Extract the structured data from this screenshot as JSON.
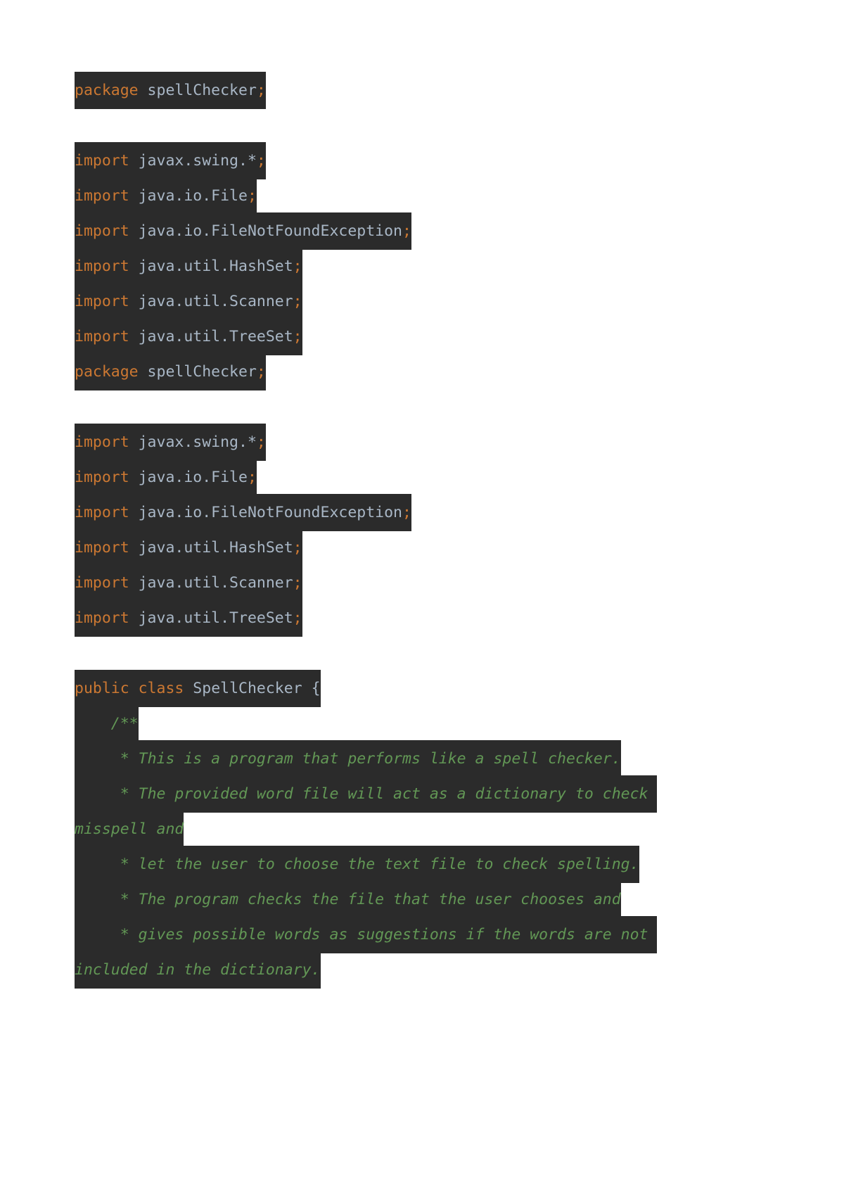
{
  "document": {
    "language": "java",
    "colors": {
      "page_background": "#ffffff",
      "code_background": "#2b2b2b",
      "keyword": "#cc7832",
      "identifier": "#a9b7c6",
      "comment": "#629755"
    }
  },
  "blocks": [
    {
      "id": "block-package-1",
      "lines": [
        {
          "id": "line-package-1",
          "kind": "package",
          "text": "package spellChecker;"
        }
      ]
    },
    {
      "id": "block-imports-1",
      "lines": [
        {
          "id": "line-import-1",
          "kind": "import",
          "text": "import javax.swing.*;"
        },
        {
          "id": "line-import-2",
          "kind": "import",
          "text": "import java.io.File;"
        },
        {
          "id": "line-import-3",
          "kind": "import",
          "text": "import java.io.FileNotFoundException;"
        },
        {
          "id": "line-import-4",
          "kind": "import",
          "text": "import java.util.HashSet;"
        },
        {
          "id": "line-import-5",
          "kind": "import",
          "text": "import java.util.Scanner;"
        },
        {
          "id": "line-import-6",
          "kind": "import",
          "text": "import java.util.TreeSet;"
        },
        {
          "id": "line-package-2",
          "kind": "package",
          "text": "package spellChecker;"
        }
      ]
    },
    {
      "id": "block-imports-2",
      "lines": [
        {
          "id": "line-import-7",
          "kind": "import",
          "text": "import javax.swing.*;"
        },
        {
          "id": "line-import-8",
          "kind": "import",
          "text": "import java.io.File;"
        },
        {
          "id": "line-import-9",
          "kind": "import",
          "text": "import java.io.FileNotFoundException;"
        },
        {
          "id": "line-import-10",
          "kind": "import",
          "text": "import java.util.HashSet;"
        },
        {
          "id": "line-import-11",
          "kind": "import",
          "text": "import java.util.Scanner;"
        },
        {
          "id": "line-import-12",
          "kind": "import",
          "text": "import java.util.TreeSet;"
        }
      ]
    },
    {
      "id": "block-class",
      "lines": [
        {
          "id": "line-class-decl",
          "kind": "class",
          "text": "public class SpellChecker {"
        },
        {
          "id": "line-javadoc-open",
          "kind": "comment",
          "text": "    /**"
        },
        {
          "id": "line-javadoc-1",
          "kind": "comment",
          "text": "     * This is a program that performs like a spell checker."
        },
        {
          "id": "line-javadoc-2",
          "kind": "comment",
          "text": "     * The provided word file will act as a dictionary to check misspell and"
        },
        {
          "id": "line-javadoc-3",
          "kind": "comment",
          "text": "     * let the user to choose the text file to check spelling."
        },
        {
          "id": "line-javadoc-4",
          "kind": "comment",
          "text": "     * The program checks the file that the user chooses and"
        },
        {
          "id": "line-javadoc-5",
          "kind": "comment",
          "text": "     * gives possible words as suggestions if the words are not included in the dictionary."
        }
      ]
    }
  ],
  "tokens": {
    "kw_package": "package",
    "kw_import": "import",
    "kw_public": "public",
    "kw_class": "class",
    "name_spellchecker_pkg": " spellChecker",
    "semicolon": ";",
    "name_swing": " javax.swing.*",
    "name_file": " java.io.File",
    "name_filenotfound": " java.io.FileNotFoundException",
    "name_hashset": " java.util.HashSet",
    "name_scanner": " java.util.Scanner",
    "name_treeset": " java.util.TreeSet",
    "name_class": " SpellChecker {"
  }
}
